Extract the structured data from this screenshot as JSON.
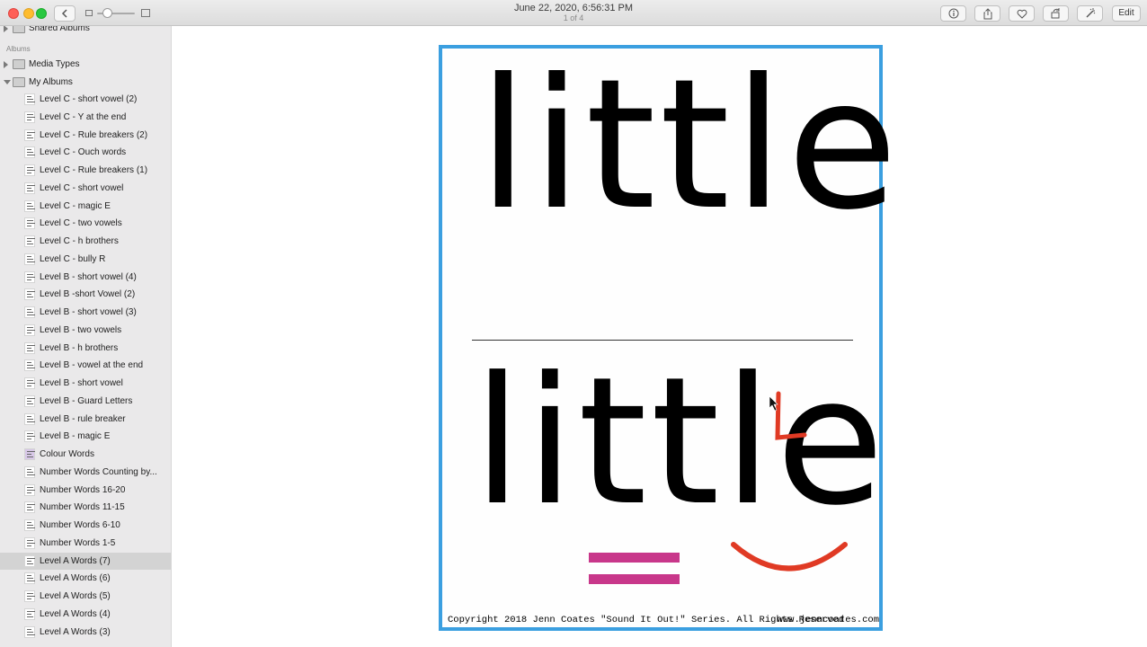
{
  "window": {
    "title": "June 22, 2020, 6:56:31 PM",
    "subtitle": "1 of 4",
    "edit_label": "Edit",
    "toolbar_icons": [
      "info-icon",
      "share-icon",
      "heart-icon",
      "rotate-icon",
      "magic-wand-icon"
    ]
  },
  "sidebar": {
    "shared_albums": "Shared Albums",
    "section_albums": "Albums",
    "media_types": "Media Types",
    "my_albums": "My Albums",
    "albums": [
      "Level C - short vowel (2)",
      "Level C - Y at the end",
      "Level C - Rule breakers (2)",
      "Level C - Ouch words",
      "Level C - Rule breakers (1)",
      "Level C - short vowel",
      "Level C - magic E",
      "Level C - two vowels",
      "Level C - h brothers",
      "Level C - bully R",
      "Level B - short vowel (4)",
      "Level B -short Vowel (2)",
      "Level B - short vowel (3)",
      "Level B - two vowels",
      "Level B - h brothers",
      "Level B - vowel at the end",
      "Level B - short vowel",
      "Level B - Guard Letters",
      "Level B - rule breaker",
      "Level B - magic E",
      "Colour Words",
      "Number Words Counting by...",
      "Number Words 16-20",
      "Number Words 11-15",
      "Number Words 6-10",
      "Number Words 1-5",
      "Level A Words (7)",
      "Level A Words (6)",
      "Level A Words (5)",
      "Level A Words (4)",
      "Level A Words (3)"
    ],
    "selected": "Level A Words (7)"
  },
  "card": {
    "word_top": "little",
    "word_bottom": "little",
    "annotation_letter": "L",
    "copyright": "Copyright 2018 Jenn Coates  \"Sound It Out!\" Series.  All Rights Reserved",
    "website": "www.jenncoates.com",
    "border_color": "#3b9fe0",
    "marker_pink": "#c8378a",
    "marker_red": "#e03a24"
  }
}
